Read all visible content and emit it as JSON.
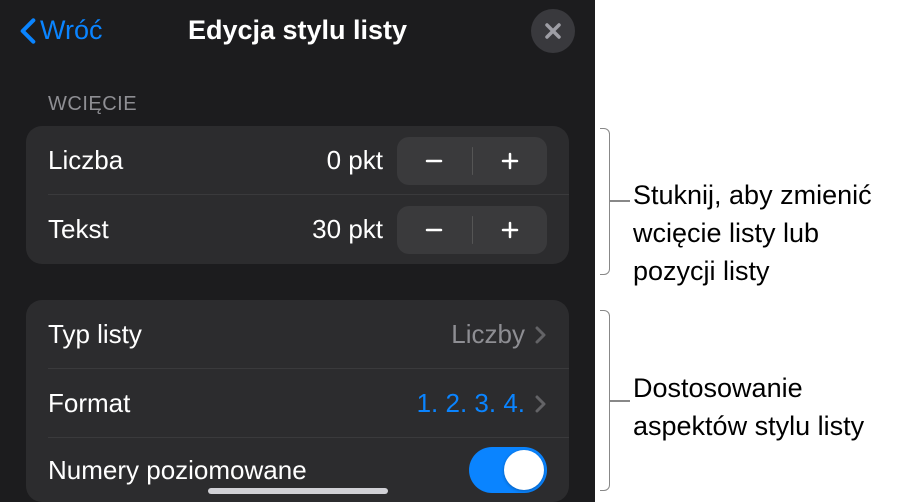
{
  "header": {
    "back_label": "Wróć",
    "title": "Edycja stylu listy"
  },
  "indent_section": {
    "header": "WCIĘCIE",
    "number_row": {
      "label": "Liczba",
      "value": "0 pkt"
    },
    "text_row": {
      "label": "Tekst",
      "value": "30 pkt"
    }
  },
  "style_section": {
    "list_type_row": {
      "label": "Typ listy",
      "value": "Liczby"
    },
    "format_row": {
      "label": "Format",
      "value": "1. 2. 3. 4."
    },
    "tiered_row": {
      "label": "Numery poziomowane",
      "on": true
    }
  },
  "callouts": {
    "c1": "Stuknij, aby zmienić wcięcie listy lub pozycji listy",
    "c2": "Dostosowanie aspektów stylu listy"
  }
}
